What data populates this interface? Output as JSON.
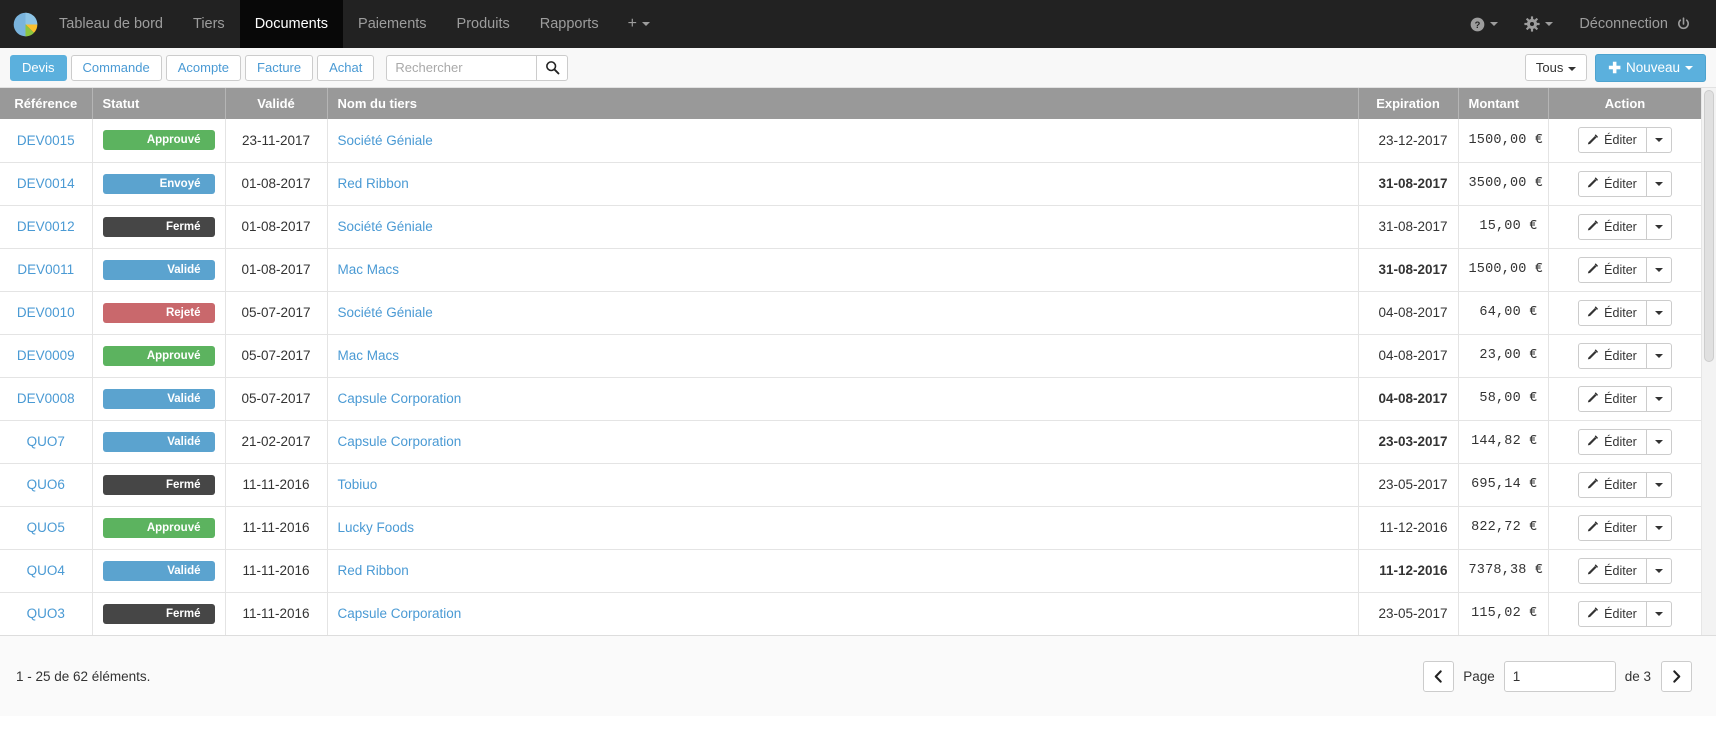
{
  "navbar": {
    "brand_icon": "pie-chart-logo",
    "items": [
      {
        "label": "Tableau de bord",
        "active": false
      },
      {
        "label": "Tiers",
        "active": false
      },
      {
        "label": "Documents",
        "active": true
      },
      {
        "label": "Paiements",
        "active": false
      },
      {
        "label": "Produits",
        "active": false
      },
      {
        "label": "Rapports",
        "active": false
      }
    ],
    "plus_menu": "+",
    "help_icon": "help-circle-icon",
    "settings_icon": "gear-icon",
    "logout_label": "Déconnection",
    "logout_icon": "power-icon",
    "bg_color": "#222222",
    "active_bg_color": "#080808"
  },
  "toolbar": {
    "type_tabs": [
      {
        "label": "Devis",
        "active": true
      },
      {
        "label": "Commande",
        "active": false
      },
      {
        "label": "Acompte",
        "active": false
      },
      {
        "label": "Facture",
        "active": false
      },
      {
        "label": "Achat",
        "active": false
      }
    ],
    "search_placeholder": "Rechercher",
    "search_value": "",
    "search_icon": "magnifier-icon",
    "filter_label": "Tous",
    "new_label": "Nouveau",
    "accent_color": "#5bb0dd"
  },
  "table": {
    "columns": [
      {
        "key": "reference",
        "label": "Référence"
      },
      {
        "key": "statut",
        "label": "Statut"
      },
      {
        "key": "valide",
        "label": "Validé"
      },
      {
        "key": "tiers",
        "label": "Nom du tiers"
      },
      {
        "key": "expiration",
        "label": "Expiration"
      },
      {
        "key": "montant",
        "label": "Montant"
      },
      {
        "key": "action",
        "label": "Action"
      }
    ],
    "action_edit_label": "Éditer",
    "action_edit_icon": "pencil-icon",
    "action_more_icon": "caret-down-icon",
    "status_colors": {
      "Approuvé": "#5cb35f",
      "Envoyé": "#5ba3cf",
      "Fermé": "#464646",
      "Validé": "#5ba3cf",
      "Rejeté": "#c9686c"
    },
    "overdue_color": "#a94442",
    "rows": [
      {
        "reference": "DEV0015",
        "statut": "Approuvé",
        "statut_class": "approuve",
        "valide": "23-11-2017",
        "tiers": "Société Géniale",
        "expiration": "23-12-2017",
        "expiration_late": false,
        "montant": "1500,00 €"
      },
      {
        "reference": "DEV0014",
        "statut": "Envoyé",
        "statut_class": "envoye",
        "valide": "01-08-2017",
        "tiers": "Red Ribbon",
        "expiration": "31-08-2017",
        "expiration_late": true,
        "montant": "3500,00 €"
      },
      {
        "reference": "DEV0012",
        "statut": "Fermé",
        "statut_class": "ferme",
        "valide": "01-08-2017",
        "tiers": "Société Géniale",
        "expiration": "31-08-2017",
        "expiration_late": false,
        "montant": "15,00 €"
      },
      {
        "reference": "DEV0011",
        "statut": "Validé",
        "statut_class": "valide",
        "valide": "01-08-2017",
        "tiers": "Mac Macs",
        "expiration": "31-08-2017",
        "expiration_late": true,
        "montant": "1500,00 €"
      },
      {
        "reference": "DEV0010",
        "statut": "Rejeté",
        "statut_class": "rejete",
        "valide": "05-07-2017",
        "tiers": "Société Géniale",
        "expiration": "04-08-2017",
        "expiration_late": false,
        "montant": "64,00 €"
      },
      {
        "reference": "DEV0009",
        "statut": "Approuvé",
        "statut_class": "approuve",
        "valide": "05-07-2017",
        "tiers": "Mac Macs",
        "expiration": "04-08-2017",
        "expiration_late": false,
        "montant": "23,00 €"
      },
      {
        "reference": "DEV0008",
        "statut": "Validé",
        "statut_class": "valide",
        "valide": "05-07-2017",
        "tiers": "Capsule Corporation",
        "expiration": "04-08-2017",
        "expiration_late": true,
        "montant": "58,00 €"
      },
      {
        "reference": "QUO7",
        "statut": "Validé",
        "statut_class": "valide",
        "valide": "21-02-2017",
        "tiers": "Capsule Corporation",
        "expiration": "23-03-2017",
        "expiration_late": true,
        "montant": "144,82 €"
      },
      {
        "reference": "QUO6",
        "statut": "Fermé",
        "statut_class": "ferme",
        "valide": "11-11-2016",
        "tiers": "Tobiuo",
        "expiration": "23-05-2017",
        "expiration_late": false,
        "montant": "695,14 €"
      },
      {
        "reference": "QUO5",
        "statut": "Approuvé",
        "statut_class": "approuve",
        "valide": "11-11-2016",
        "tiers": "Lucky Foods",
        "expiration": "11-12-2016",
        "expiration_late": false,
        "montant": "822,72 €"
      },
      {
        "reference": "QUO4",
        "statut": "Validé",
        "statut_class": "valide",
        "valide": "11-11-2016",
        "tiers": "Red Ribbon",
        "expiration": "11-12-2016",
        "expiration_late": true,
        "montant": "7378,38 €"
      },
      {
        "reference": "QUO3",
        "statut": "Fermé",
        "statut_class": "ferme",
        "valide": "11-11-2016",
        "tiers": "Capsule Corporation",
        "expiration": "23-05-2017",
        "expiration_late": false,
        "montant": "115,02 €"
      }
    ]
  },
  "footer": {
    "count_text": "1 - 25 de 62 éléments.",
    "prev_icon": "chevron-left-icon",
    "next_icon": "chevron-right-icon",
    "page_label": "Page",
    "page_value": "1",
    "of_label": "de 3"
  }
}
